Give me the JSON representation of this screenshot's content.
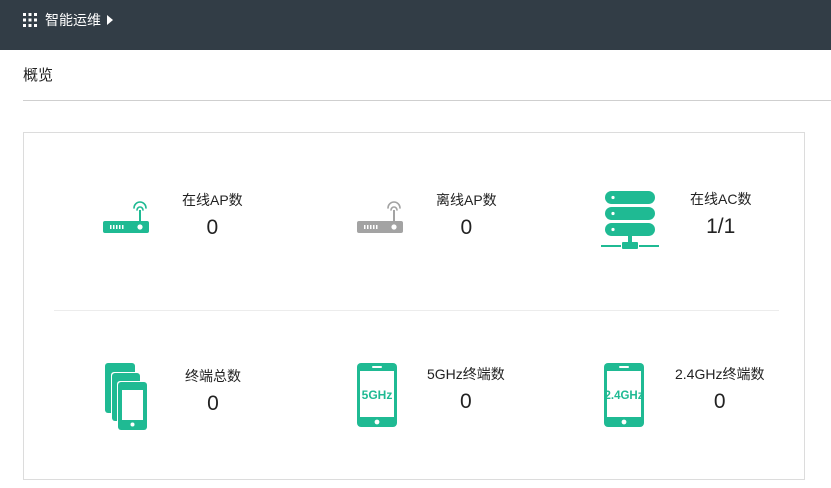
{
  "header": {
    "app_label": "智能运维"
  },
  "page": {
    "title": "概览"
  },
  "colors": {
    "topbar": "#323d46",
    "accent": "#1fba93",
    "offline": "#a3a3a3"
  },
  "stats": {
    "online_ap": {
      "label": "在线AP数",
      "value": "0",
      "icon": "router-online-icon"
    },
    "offline_ap": {
      "label": "离线AP数",
      "value": "0",
      "icon": "router-offline-icon"
    },
    "online_ac": {
      "label": "在线AC数",
      "value": "1/1",
      "icon": "server-stack-icon"
    },
    "total_terminals": {
      "label": "终端总数",
      "value": "0",
      "icon": "devices-stack-icon"
    },
    "terminals_5g": {
      "label": "5GHz终端数",
      "value": "0",
      "icon": "phone-5ghz-icon",
      "badge": "5GHz"
    },
    "terminals_24g": {
      "label": "2.4GHz终端数",
      "value": "0",
      "icon": "phone-24ghz-icon",
      "badge": "2.4GHz"
    }
  }
}
